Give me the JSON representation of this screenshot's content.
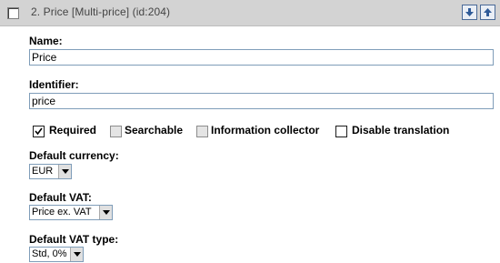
{
  "header": {
    "title": "2. Price [Multi-price] (id:204)"
  },
  "fields": {
    "name_label": "Name:",
    "name_value": "Price",
    "identifier_label": "Identifier:",
    "identifier_value": "price"
  },
  "options": [
    {
      "label": "Required",
      "checked": true,
      "enabled": true
    },
    {
      "label": "Searchable",
      "checked": false,
      "enabled": false
    },
    {
      "label": "Information collector",
      "checked": false,
      "enabled": false
    },
    {
      "label": "Disable translation",
      "checked": false,
      "enabled": true
    }
  ],
  "default_currency": {
    "label": "Default currency:",
    "selected": "EUR"
  },
  "default_vat": {
    "label": "Default VAT:",
    "selected": "Price ex. VAT"
  },
  "default_vat_type": {
    "label": "Default VAT type:",
    "selected": "Std, 0%"
  },
  "icons": {
    "move_down": "arrow-down-icon",
    "move_up": "arrow-up-icon"
  },
  "colors": {
    "header_bg": "#d3d3d3",
    "input_border": "#7f9db9",
    "arrow_blue": "#2f5b98"
  }
}
